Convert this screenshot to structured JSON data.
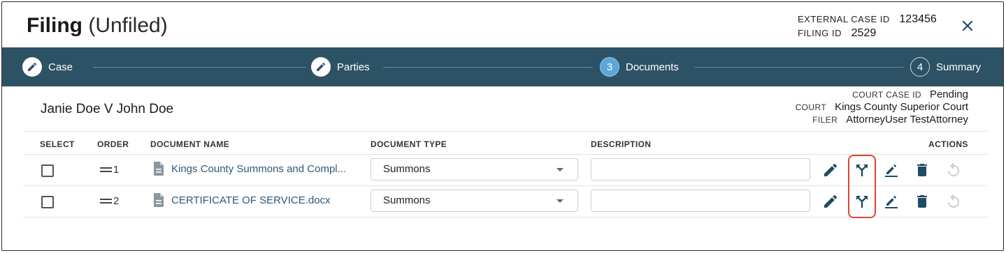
{
  "header": {
    "title": "Filing",
    "subtitle": "(Unfiled)",
    "external_case_id_label": "EXTERNAL CASE ID",
    "external_case_id": "123456",
    "filing_id_label": "FILING ID",
    "filing_id": "2529"
  },
  "stepper": {
    "steps": [
      {
        "label": "Case",
        "marker": "",
        "state": "done"
      },
      {
        "label": "Parties",
        "marker": "",
        "state": "done"
      },
      {
        "label": "Documents",
        "marker": "3",
        "state": "active"
      },
      {
        "label": "Summary",
        "marker": "4",
        "state": "todo"
      }
    ]
  },
  "case": {
    "name": "Janie Doe V John Doe",
    "court_case_id_label": "COURT CASE ID",
    "court_case_id": "Pending",
    "court_label": "COURT",
    "court": "Kings County Superior Court",
    "filer_label": "FILER",
    "filer": "AttorneyUser TestAttorney"
  },
  "table": {
    "headers": {
      "select": "SELECT",
      "order": "ORDER",
      "document_name": "DOCUMENT NAME",
      "document_type": "DOCUMENT TYPE",
      "description": "DESCRIPTION",
      "actions": "ACTIONS"
    },
    "rows": [
      {
        "order": "1",
        "name": "Kings County Summons and Compl...",
        "type": "Summons",
        "description": ""
      },
      {
        "order": "2",
        "name": "CERTIFICATE OF SERVICE.docx",
        "type": "Summons",
        "description": ""
      }
    ]
  },
  "icons": {
    "close": "close-icon",
    "step_done": "pencil-icon",
    "document": "document-icon",
    "edit": "pencil-icon",
    "split": "split-icon",
    "sign": "signature-icon",
    "delete": "trash-icon",
    "undo": "undo-icon"
  },
  "colors": {
    "stepper_bg": "#2d5266",
    "active_step": "#5aa7d8",
    "link": "#2a5a78",
    "highlight": "#e0442f",
    "icon_dark": "#1f4b63"
  }
}
